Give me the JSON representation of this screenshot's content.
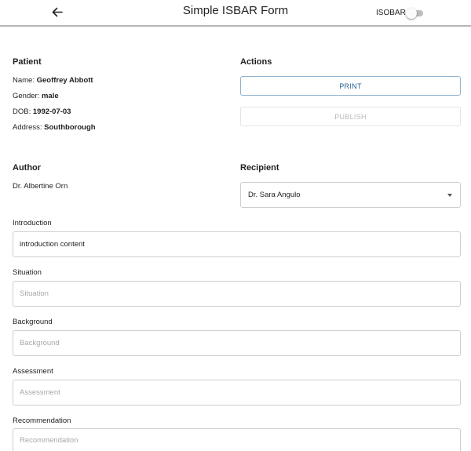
{
  "header": {
    "title": "Simple ISBAR Form",
    "toggle_label": "ISOBAR",
    "toggle_on": false
  },
  "patient": {
    "heading": "Patient",
    "name_label": "Name:",
    "name": "Geoffrey Abbott",
    "gender_label": "Gender:",
    "gender": "male",
    "dob_label": "DOB:",
    "dob": "1992-07-03",
    "address_label": "Address:",
    "address": "Southborough"
  },
  "actions": {
    "heading": "Actions",
    "print_label": "PRINT",
    "publish_label": "PUBLISH",
    "publish_enabled": false
  },
  "author": {
    "heading": "Author",
    "name": "Dr. Albertine Orn"
  },
  "recipient": {
    "heading": "Recipient",
    "selected": "Dr. Sara Angulo"
  },
  "fields": {
    "introduction": {
      "label": "Introduction",
      "value": "introduction content",
      "placeholder": "Introduction"
    },
    "situation": {
      "label": "Situation",
      "value": "",
      "placeholder": "Situation"
    },
    "background": {
      "label": "Background",
      "value": "",
      "placeholder": "Background"
    },
    "assessment": {
      "label": "Assessment",
      "value": "",
      "placeholder": "Assessment"
    },
    "recommendation": {
      "label": "Recommendation",
      "value": "",
      "placeholder": "Recommendation"
    }
  },
  "colors": {
    "accent": "#1f5f93",
    "divider": "#b5b5b5",
    "field_border": "#cfcfcf",
    "disabled_text": "#b8b8b8"
  }
}
